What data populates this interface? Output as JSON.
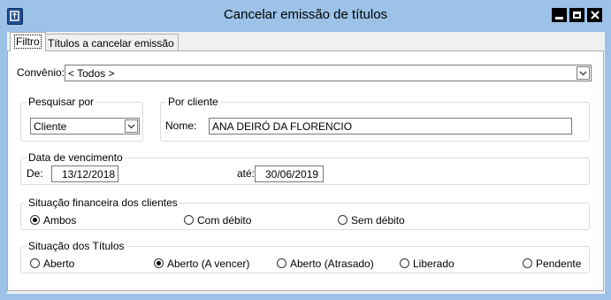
{
  "window": {
    "title": "Cancelar emissão de títulos",
    "icon": "app-icon"
  },
  "tabs": [
    {
      "label": "Filtro",
      "active": true
    },
    {
      "label": "Títulos a cancelar emissão",
      "active": false
    }
  ],
  "filter": {
    "convenio_label": "Convênio:",
    "convenio_value": "< Todos >",
    "pesquisar": {
      "legend": "Pesquisar por",
      "value": "Cliente"
    },
    "por_cliente": {
      "legend": "Por cliente",
      "nome_label": "Nome:",
      "nome_value": "ANA DEIRÓ DA FLORENCIO"
    },
    "vencimento": {
      "legend": "Data de vencimento",
      "de_label": "De:",
      "de_value": "13/12/2018",
      "ate_label": "até:",
      "ate_value": "30/06/2019"
    },
    "situacao_financeira": {
      "legend": "Situação financeira dos clientes",
      "options": [
        {
          "label": "Ambos",
          "checked": true
        },
        {
          "label": "Com débito",
          "checked": false
        },
        {
          "label": "Sem débito",
          "checked": false
        }
      ]
    },
    "situacao_titulos": {
      "legend": "Situação dos Títulos",
      "options": [
        {
          "label": "Aberto",
          "checked": false
        },
        {
          "label": "Aberto (A vencer)",
          "checked": true
        },
        {
          "label": "Aberto (Atrasado)",
          "checked": false
        },
        {
          "label": "Liberado",
          "checked": false
        },
        {
          "label": "Pendente",
          "checked": false
        }
      ]
    }
  }
}
